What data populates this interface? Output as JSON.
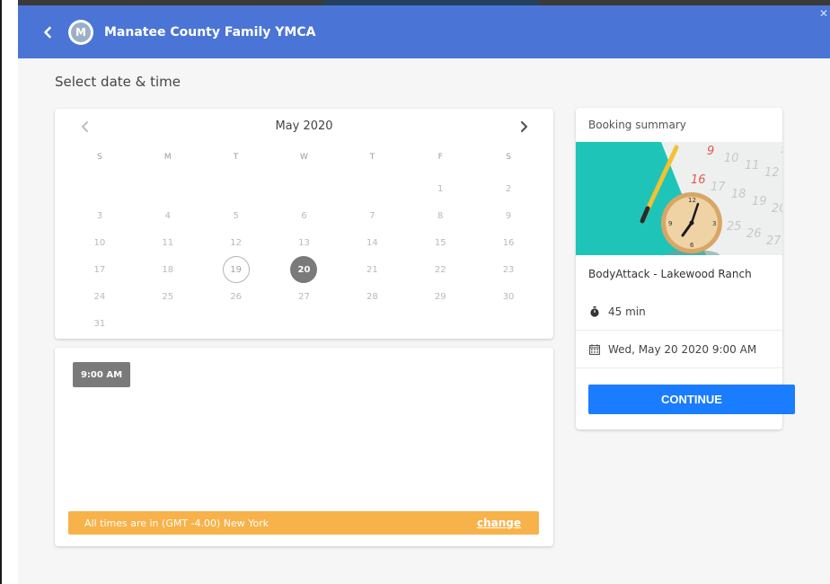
{
  "header": {
    "org_name": "Manatee County Family YMCA",
    "logo_letter": "M",
    "bg_color": "#4a74d6"
  },
  "page_title": "Select date & time",
  "calendar": {
    "month_label": "May 2020",
    "weekdays": [
      "S",
      "M",
      "T",
      "W",
      "T",
      "F",
      "S"
    ],
    "leading_blanks": 5,
    "days": [
      "1",
      "2",
      "3",
      "4",
      "5",
      "6",
      "7",
      "8",
      "9",
      "10",
      "11",
      "12",
      "13",
      "14",
      "15",
      "16",
      "17",
      "18",
      "19",
      "20",
      "21",
      "22",
      "23",
      "24",
      "25",
      "26",
      "27",
      "28",
      "29",
      "30",
      "31"
    ],
    "today": "19",
    "selected": "20"
  },
  "times": {
    "slots": [
      "9:00 AM"
    ],
    "timezone_text": "All times are in (GMT -4.00) New York",
    "change_label": "change",
    "tz_bar_color": "#f8b24a"
  },
  "summary": {
    "title": "Booking summary",
    "class_name": "BodyAttack - Lakewood Ranch",
    "duration": "45 min",
    "datetime": "Wed, May 20 2020 9:00 AM",
    "continue_label": "CONTINUE",
    "continue_color": "#1a7cff"
  },
  "icons": {
    "back": "chevron-left-icon",
    "prev_month": "chevron-left-icon",
    "next_month": "chevron-right-icon",
    "duration": "stopwatch-icon",
    "date": "calendar-icon"
  }
}
